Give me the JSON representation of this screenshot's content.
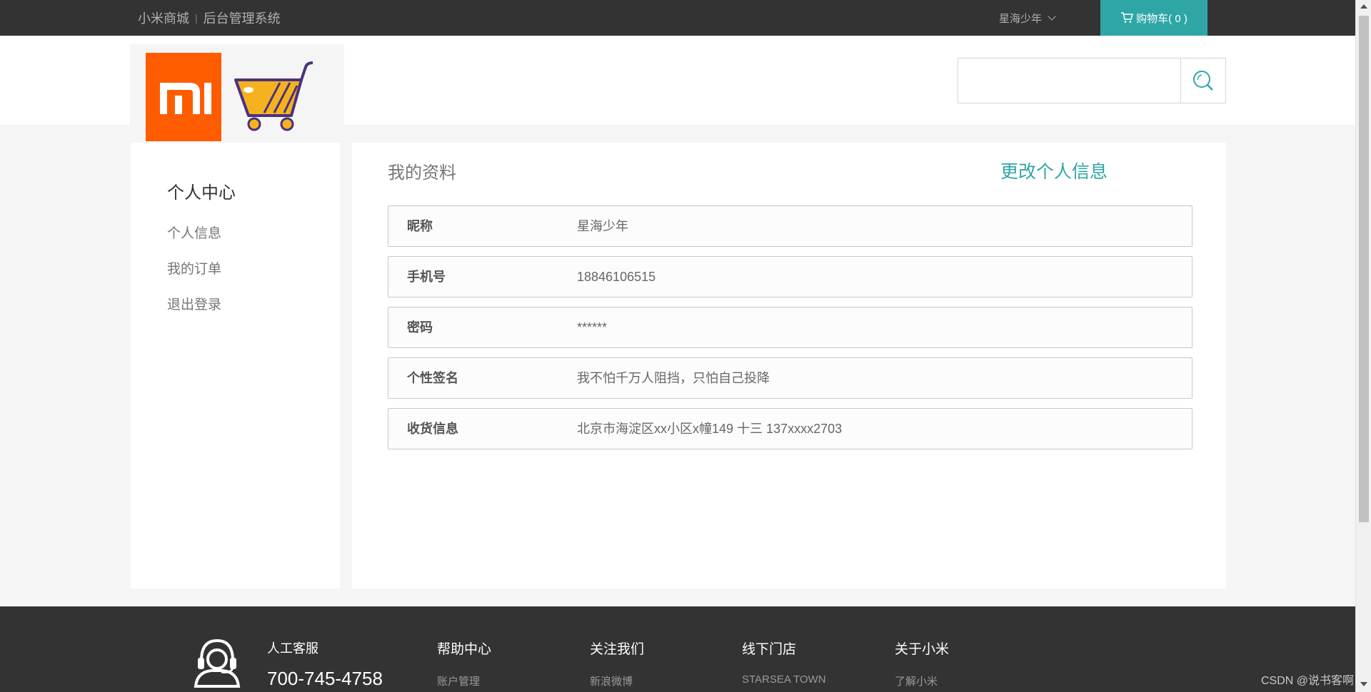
{
  "topbar": {
    "mall_link": "小米商城",
    "admin_link": "后台管理系统",
    "username": "星海少年",
    "cart_label": "购物车( 0 )"
  },
  "header": {
    "search_placeholder": ""
  },
  "sidebar": {
    "title": "个人中心",
    "items": [
      {
        "label": "个人信息"
      },
      {
        "label": "我的订单"
      },
      {
        "label": "退出登录"
      }
    ]
  },
  "profile": {
    "title": "我的资料",
    "edit_label": "更改个人信息",
    "rows": [
      {
        "key": "昵称",
        "value": "星海少年"
      },
      {
        "key": "手机号",
        "value": "18846106515"
      },
      {
        "key": "密码",
        "value": "******"
      },
      {
        "key": "个性签名",
        "value": "我不怕千万人阻挡，只怕自己投降"
      },
      {
        "key": "收货信息",
        "value": "北京市海淀区xx小区x幢149 十三 137xxxx2703"
      }
    ]
  },
  "footer": {
    "service_title": "人工客服",
    "phone": "700-745-4758",
    "columns": [
      {
        "title": "帮助中心",
        "sub": "账户管理"
      },
      {
        "title": "关注我们",
        "sub": "新浪微博"
      },
      {
        "title": "线下门店",
        "sub": "STARSEA TOWN"
      },
      {
        "title": "关于小米",
        "sub": "了解小米"
      }
    ]
  },
  "watermark": "CSDN @说书客啊",
  "colors": {
    "accent": "#2fa6a6",
    "topbar": "#333333",
    "mi_orange": "#ff5c00"
  }
}
